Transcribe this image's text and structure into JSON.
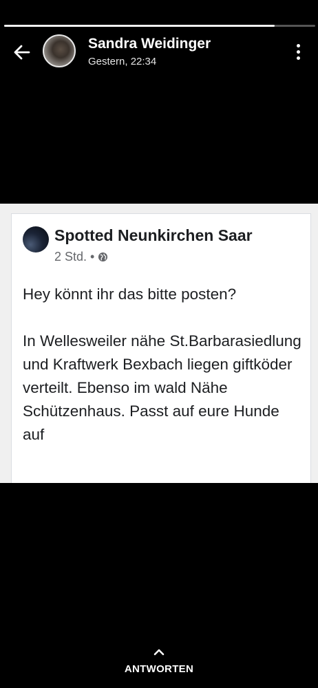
{
  "story": {
    "progress_fraction": 0.87,
    "sender_name": "Sandra Weidinger",
    "timestamp": "Gestern, 22:34",
    "icons": {
      "back": "arrow-left-icon",
      "more": "more-vertical-icon",
      "reply": "chevron-up-icon"
    }
  },
  "post": {
    "page_name": "Spotted Neunkirchen Saar",
    "time_ago": "2 Std.",
    "separator": "•",
    "audience_icon": "globe-icon",
    "text": "Hey könnt ihr das bitte posten?\n\nIn Wellesweiler nähe St.Barbarasiedlung und Kraftwerk Bexbach liegen giftköder verteilt. Ebenso im wald Nähe Schützenhaus. Passt auf eure Hunde auf"
  },
  "footer": {
    "reply_label": "ANTWORTEN"
  }
}
